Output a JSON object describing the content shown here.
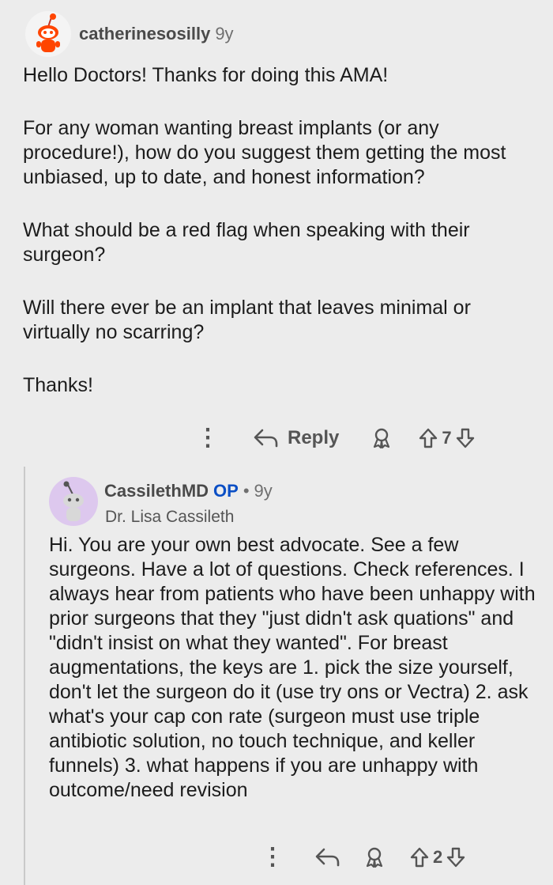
{
  "comment1": {
    "username": "catherinesosilly",
    "age": "9y",
    "paragraphs": [
      "Hello Doctors! Thanks for doing this AMA!",
      "For any woman wanting breast implants (or any procedure!), how do you suggest them getting the most unbiased, up to date, and honest information?",
      "What should be a red flag when speaking with their surgeon?",
      "Will there ever be an implant that leaves minimal or virtually no scarring?",
      "Thanks!"
    ],
    "actions": {
      "more": "⋮",
      "reply_label": "Reply",
      "vote_count": "7"
    }
  },
  "comment2": {
    "username": "CassilethMD",
    "op_badge": "OP",
    "separator": "•",
    "age": "9y",
    "flair": "Dr. Lisa Cassileth",
    "body": "Hi. You are your own best advocate. See a few surgeons. Have a lot of questions. Check references. I always hear from patients who have been unhappy with prior surgeons that they \"just didn't ask quations\" and \"didn't insist on what they wanted\". For breast augmentations, the keys are 1. pick the size yourself, don't let the surgeon do it (use try ons or Vectra) 2. ask what's your cap con rate (surgeon must use triple antibiotic solution, no touch technique, and keller funnels) 3. what happens if you are unhappy with outcome/need revision",
    "actions": {
      "more": "⋮",
      "vote_count": "2"
    }
  },
  "colors": {
    "background": "#ececec",
    "op_badge": "#0b4fc5",
    "avatar2_bg": "#ddc8ee",
    "snoo_orange": "#ff4500"
  }
}
